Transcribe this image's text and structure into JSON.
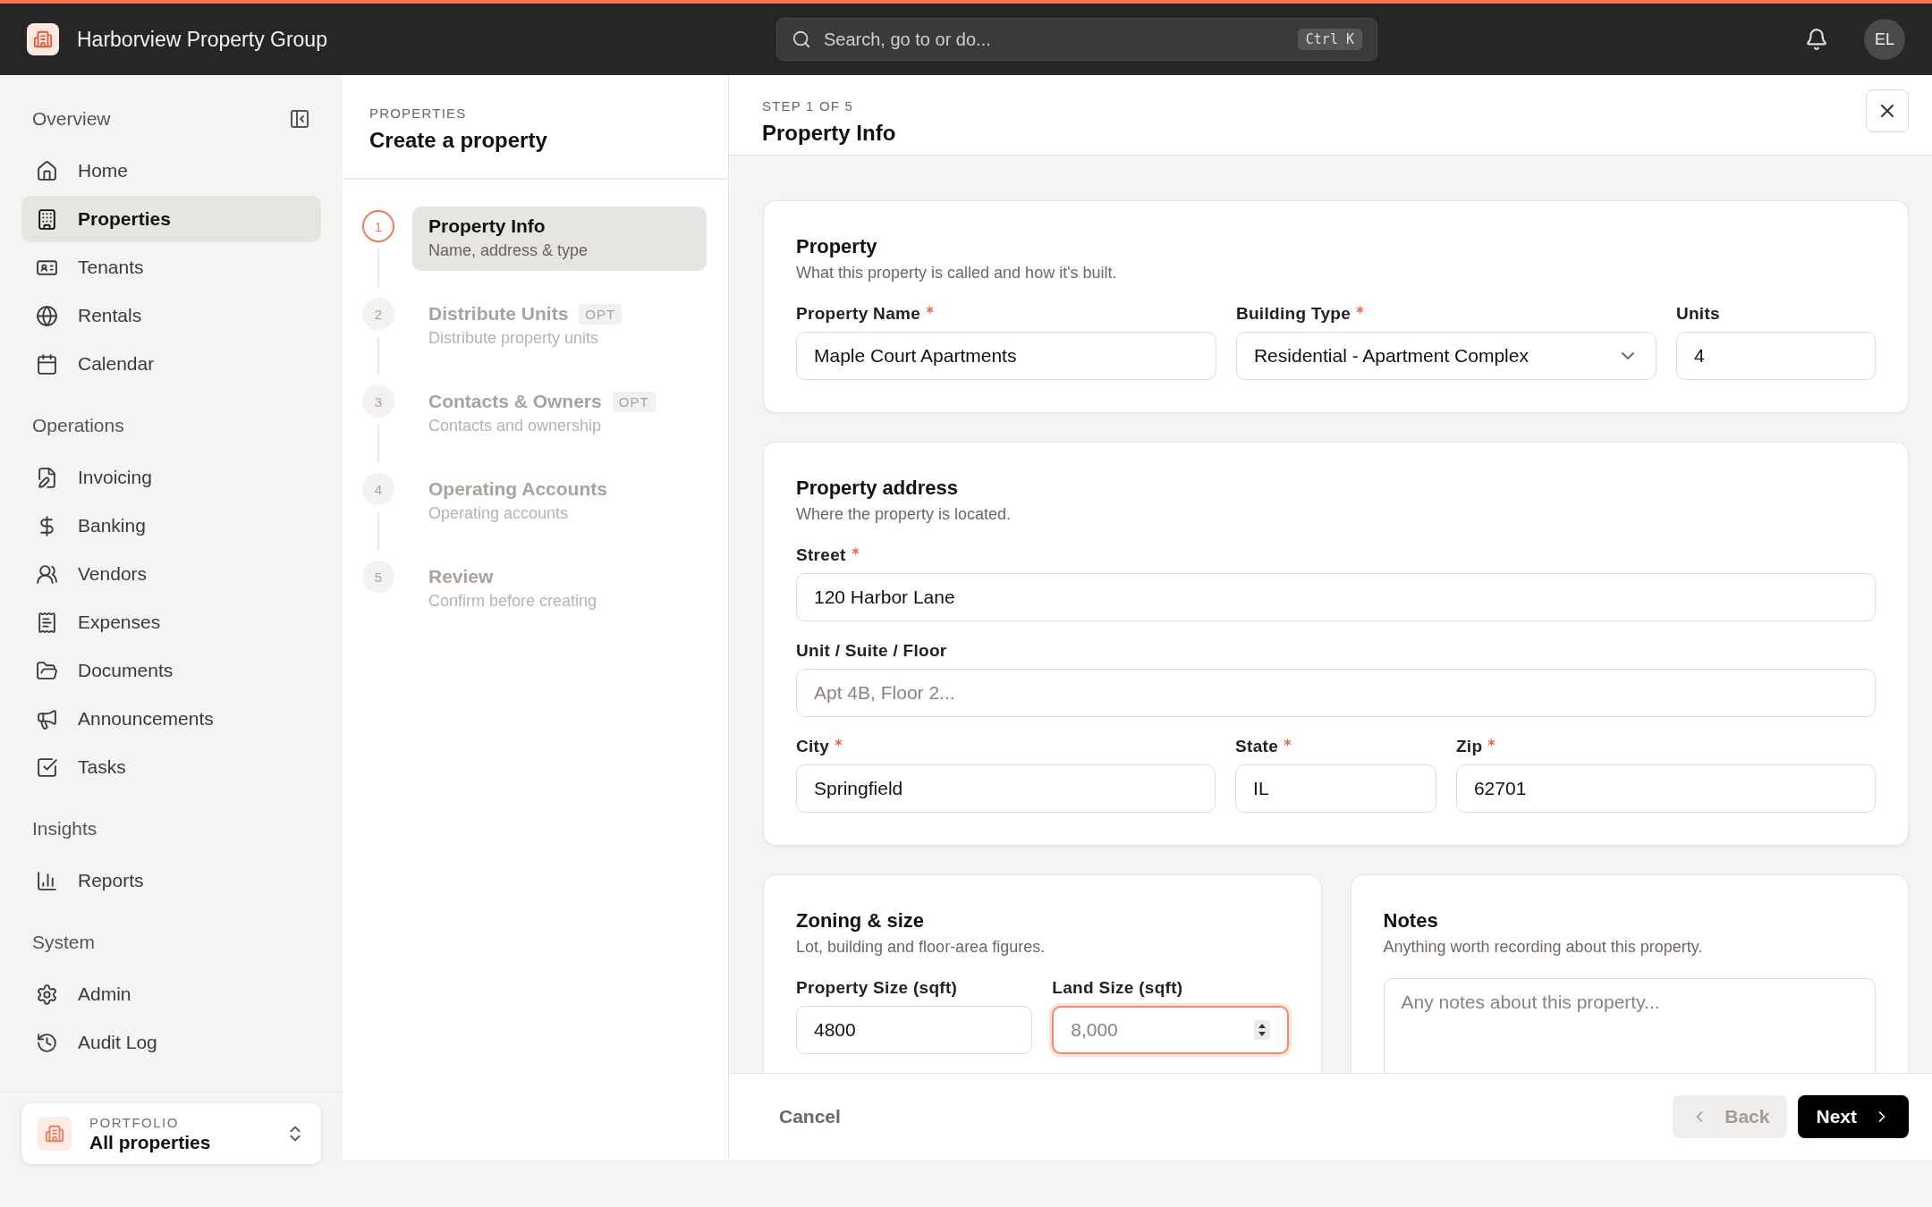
{
  "app": {
    "title": "Harborview Property Group"
  },
  "search": {
    "placeholder": "Search, go to or do...",
    "shortcut": "Ctrl K"
  },
  "user": {
    "initials": "EL"
  },
  "sidebar": {
    "sections": [
      {
        "title": "Overview",
        "items": [
          {
            "label": "Home",
            "selected": false
          },
          {
            "label": "Properties",
            "selected": true
          },
          {
            "label": "Tenants",
            "selected": false
          },
          {
            "label": "Rentals",
            "selected": false
          },
          {
            "label": "Calendar",
            "selected": false
          }
        ]
      },
      {
        "title": "Operations",
        "items": [
          {
            "label": "Invoicing",
            "selected": false
          },
          {
            "label": "Banking",
            "selected": false
          },
          {
            "label": "Vendors",
            "selected": false
          },
          {
            "label": "Expenses",
            "selected": false
          },
          {
            "label": "Documents",
            "selected": false
          },
          {
            "label": "Announcements",
            "selected": false
          },
          {
            "label": "Tasks",
            "selected": false
          }
        ]
      },
      {
        "title": "Insights",
        "items": [
          {
            "label": "Reports",
            "selected": false
          }
        ]
      },
      {
        "title": "System",
        "items": [
          {
            "label": "Admin",
            "selected": false
          },
          {
            "label": "Audit Log",
            "selected": false
          }
        ]
      }
    ],
    "portfolio": {
      "label": "PORTFOLIO",
      "value": "All properties"
    }
  },
  "wizard": {
    "eyebrow": "PROPERTIES",
    "title": "Create a property",
    "steps": [
      {
        "number": "1",
        "title": "Property Info",
        "subtitle": "Name, address & type",
        "selected": true
      },
      {
        "number": "2",
        "title": "Distribute Units",
        "subtitle": "Distribute property units",
        "badge": "OPT",
        "selected": false
      },
      {
        "number": "3",
        "title": "Contacts & Owners",
        "subtitle": "Contacts and ownership",
        "badge": "OPT",
        "selected": false
      },
      {
        "number": "4",
        "title": "Operating Accounts",
        "subtitle": "Operating accounts",
        "selected": false
      },
      {
        "number": "5",
        "title": "Review",
        "subtitle": "Confirm before creating",
        "selected": false
      }
    ]
  },
  "step_header": {
    "eyebrow": "STEP 1 OF 5",
    "title": "Property Info"
  },
  "sections": [
    {
      "title": "Property",
      "description": "What this property is called and how it's built.",
      "rows": [
        [
          {
            "label": "Property Name",
            "required": true,
            "kind": "text",
            "value": "Maple Court Apartments"
          },
          {
            "label": "Building Type",
            "required": true,
            "kind": "select",
            "value": "Residential - Apartment Complex"
          },
          {
            "label": "Units",
            "required": false,
            "kind": "text",
            "value": "4"
          }
        ]
      ]
    },
    {
      "title": "Property address",
      "description": "Where the property is located.",
      "rows": [
        [
          {
            "label": "Street",
            "required": true,
            "kind": "text",
            "value": "120 Harbor Lane"
          }
        ],
        [
          {
            "label": "Unit / Suite / Floor",
            "required": false,
            "kind": "text",
            "placeholder": "Apt 4B, Floor 2..."
          }
        ],
        [
          {
            "label": "City",
            "required": true,
            "kind": "text",
            "value": "Springfield"
          },
          {
            "label": "State",
            "required": true,
            "kind": "text",
            "value": "IL"
          },
          {
            "label": "Zip",
            "required": true,
            "kind": "text",
            "value": "62701"
          }
        ]
      ]
    },
    {
      "title": "Zoning & size",
      "description": "Lot, building and floor-area figures.",
      "rows": [
        [
          {
            "label": "Property Size (sqft)",
            "required": false,
            "kind": "text",
            "value": "4800"
          },
          {
            "label": "Land Size (sqft)",
            "required": false,
            "kind": "number",
            "placeholder": "8,000",
            "focused": true
          }
        ]
      ]
    },
    {
      "title": "Notes",
      "description": "Anything worth recording about this property.",
      "rows": [
        [
          {
            "kind": "textarea",
            "placeholder": "Any notes about this property..."
          }
        ]
      ]
    }
  ],
  "footer": {
    "cancel": "Cancel",
    "back": {
      "label": "Back",
      "disabled": true
    },
    "next": {
      "label": "Next",
      "disabled": false
    }
  }
}
